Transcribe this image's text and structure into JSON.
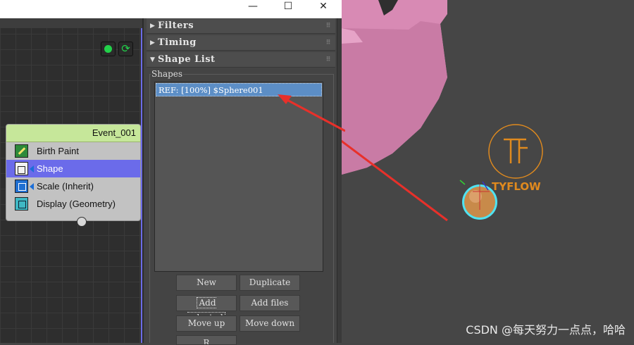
{
  "window": {
    "controls": {
      "minimize": "—",
      "maximize": "☐",
      "close": "✕"
    }
  },
  "flow": {
    "toolbar_icons": [
      "record-icon",
      "refresh-icon"
    ],
    "event": {
      "title": "Event_001",
      "operators": [
        {
          "label": "Birth Paint",
          "icon": "birth-paint-icon",
          "selected": false
        },
        {
          "label": "Shape",
          "icon": "shape-icon",
          "selected": true
        },
        {
          "label": "Scale (Inherit)",
          "icon": "scale-icon",
          "selected": false
        },
        {
          "label": "Display (Geometry)",
          "icon": "display-icon",
          "selected": false
        }
      ]
    }
  },
  "panel": {
    "rollouts": [
      {
        "label": "Filters",
        "expanded": false
      },
      {
        "label": "Timing",
        "expanded": false
      },
      {
        "label": "Shape List",
        "expanded": true
      }
    ],
    "shapes_group_label": "Shapes",
    "shape_list_items": [
      "REF: [100%] $Sphere001"
    ],
    "buttons": {
      "new": "New",
      "duplicate": "Duplicate",
      "add_selected": "Add selected",
      "add_files": "Add files",
      "move_up": "Move up",
      "move_down": "Move down",
      "remove": "R"
    }
  },
  "viewport": {
    "logo_text": "TYFLOW",
    "logo_letter": "F",
    "watermark": "CSDN @每天努力一点点，哈哈",
    "colors": {
      "teapot": "#d88ab4",
      "sphere": "#c88a4a",
      "logo": "#e08a1e",
      "selection": "#4fe3f2",
      "annotation_arrow": "#e8302a"
    }
  }
}
